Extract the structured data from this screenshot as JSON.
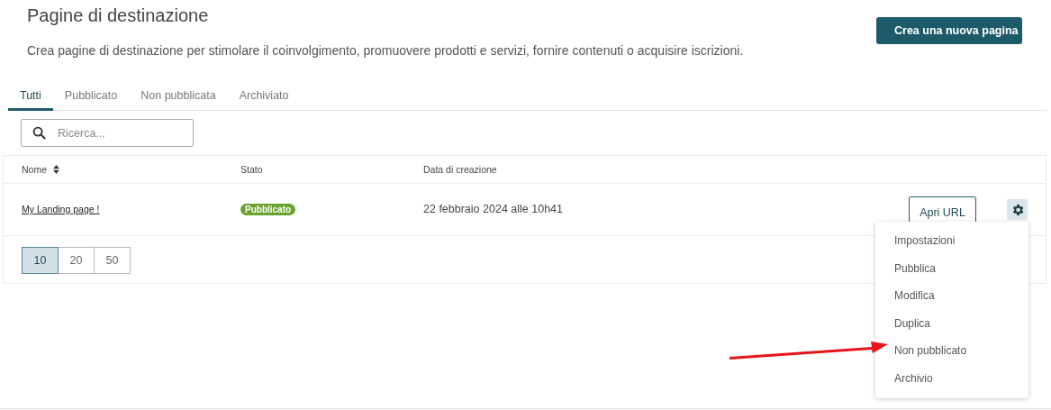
{
  "title": "Pagine di destinazione",
  "description": "Crea pagine di destinazione per stimolare il coinvolgimento, promuovere prodotti e servizi, fornire contenuti o acquisire iscrizioni.",
  "create_button": "Crea una nuova pagina",
  "tabs": [
    {
      "label": "Tutti",
      "selected": true
    },
    {
      "label": "Pubblicato",
      "selected": false
    },
    {
      "label": "Non pubblicata",
      "selected": false
    },
    {
      "label": "Archiviato",
      "selected": false
    }
  ],
  "search": {
    "placeholder": "Ricerca..."
  },
  "table": {
    "columns": [
      {
        "label": "Nome",
        "sortable": true
      },
      {
        "label": "Stato",
        "sortable": false
      },
      {
        "label": "Data di creazione",
        "sortable": false
      }
    ],
    "rows": [
      {
        "name": "My Landing page !",
        "status": {
          "label": "Pubblicato",
          "kind": "published"
        },
        "created": "22 febbraio 2024 alle 10h41",
        "open_button": "Apri URL",
        "menu_open": true
      }
    ]
  },
  "page_sizes": [
    {
      "label": "10",
      "selected": true
    },
    {
      "label": "20",
      "selected": false
    },
    {
      "label": "50",
      "selected": false
    }
  ],
  "row_menu": [
    {
      "label": "Impostazioni",
      "pointed": false
    },
    {
      "label": "Pubblica",
      "pointed": false
    },
    {
      "label": "Modifica",
      "pointed": false
    },
    {
      "label": "Duplica",
      "pointed": false
    },
    {
      "label": "Non pubblicato",
      "pointed": true
    },
    {
      "label": "Archivio",
      "pointed": false
    }
  ]
}
